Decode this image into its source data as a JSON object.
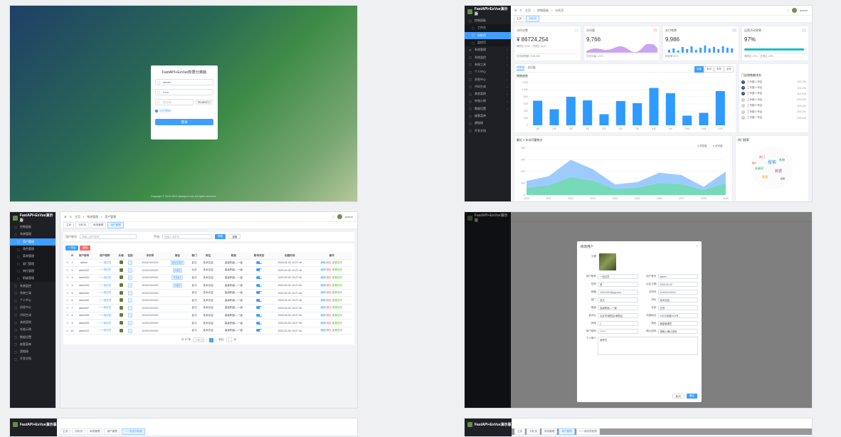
{
  "login": {
    "title": "FastAPI+EsVue权限分离版",
    "username": "admin",
    "password": "••••••",
    "captcha_placeholder": "验证码",
    "captcha_image": "Roded二",
    "remember": "记住密码",
    "submit": "登录",
    "copyright": "Copyright © 2019-2024 ujtangson.com All rights reserved."
  },
  "shell": {
    "brand": "FastAPI+EsVue演示版",
    "user": "admin",
    "breadcrumb": [
      "主页",
      "系统管理",
      "用户管理"
    ],
    "menu": [
      {
        "label": "控制面板",
        "icon": "▢"
      },
      {
        "label": "工作台",
        "icon": "▢",
        "sub": true
      },
      {
        "label": "分析页",
        "icon": "▢",
        "sub": true,
        "active": true
      },
      {
        "label": "监控页",
        "icon": "▢",
        "sub": true
      },
      {
        "label": "系统管理",
        "icon": "⚙",
        "arrow": "⌄"
      },
      {
        "label": "系统监控",
        "icon": "▢",
        "arrow": "⌄"
      },
      {
        "label": "系统工具",
        "icon": "▢",
        "arrow": "⌄"
      },
      {
        "label": "个人中心",
        "icon": "▢",
        "arrow": "⌄"
      },
      {
        "label": "消息中心",
        "icon": "▢",
        "arrow": "⌄"
      },
      {
        "label": "代码生成",
        "icon": "▢",
        "arrow": "⌄"
      },
      {
        "label": "其他案例",
        "icon": "▢",
        "arrow": "⌄"
      },
      {
        "label": "外链示例",
        "icon": "▢",
        "arrow": "⌄"
      },
      {
        "label": "数据设置",
        "icon": "▢",
        "arrow": "⌄"
      },
      {
        "label": "嵌套菜单",
        "icon": "▢"
      },
      {
        "label": "超链接",
        "icon": "▢"
      },
      {
        "label": "开发文档",
        "icon": "▢"
      }
    ]
  },
  "dashboard": {
    "tabs": [
      "主页",
      "分析页"
    ],
    "cards": [
      {
        "title": "访问次数",
        "value": "¥ 86724,254",
        "sub": "周同比 12% ↑  日同比 11% ↓",
        "foot": "日均销售额 ￥86,000",
        "badge_color": "#e6f7ff"
      },
      {
        "title": "访问量",
        "value": "9,766",
        "sub": "",
        "foot": "日访问量 1,970",
        "badge_color": "#fde2e2"
      },
      {
        "title": "支付笔数",
        "value": "9,986",
        "sub": "",
        "foot": "转化率 60%",
        "badge_color": "#d9ecff"
      },
      {
        "title": "运营活动效果",
        "value": "97%",
        "sub": "",
        "foot": "周同比 47% ↑  日同比 12% ↓",
        "badge_color": "#e1f3d8",
        "progress": 0.97
      }
    ],
    "panel_tabs": [
      "销售额",
      "访问量"
    ],
    "panel_title": "销售趋势",
    "range_buttons": [
      "本周",
      "本月",
      "本年",
      "全年"
    ],
    "rank_title": "门店销售额排名",
    "rank": [
      {
        "n": "1",
        "name": "工专路 1 号店",
        "v": "323,234"
      },
      {
        "n": "2",
        "name": "工专路 2 号店",
        "v": "323,234"
      },
      {
        "n": "3",
        "name": "工专路 3 号店",
        "v": "323,234"
      },
      {
        "n": "4",
        "name": "工专路 4 号店",
        "v": "323,234"
      },
      {
        "n": "5",
        "name": "工专路 5 号店",
        "v": "323,234"
      },
      {
        "n": "6",
        "name": "工专路 6 号店",
        "v": "323,234"
      },
      {
        "n": "7",
        "name": "工专路 7 号店",
        "v": "323,234"
      }
    ],
    "lower_title": "最近 1 年访问量统计",
    "legend": [
      "浏览量",
      "访问量"
    ],
    "cloud_title": "热门搜索"
  },
  "chart_data": [
    {
      "type": "bar",
      "categories": [
        "1月",
        "2月",
        "3月",
        "4月",
        "5月",
        "6月",
        "7月",
        "8月",
        "9月",
        "10月",
        "11月",
        "12月"
      ],
      "values": [
        690,
        450,
        800,
        700,
        310,
        680,
        620,
        1050,
        900,
        270,
        350,
        960
      ],
      "ylim": [
        0,
        1200
      ],
      "yticks": [
        "0",
        "200",
        "400",
        "600",
        "800",
        "1,000",
        "1,200"
      ],
      "color": "#2f9bff"
    },
    {
      "type": "area",
      "x": [
        "2020",
        "2021",
        "2022",
        "2023",
        "2024",
        "2025",
        "2026",
        "2027",
        "2028",
        "2029"
      ],
      "series": [
        {
          "name": "浏览量",
          "values": [
            120,
            160,
            300,
            220,
            90,
            110,
            190,
            170,
            70,
            200
          ],
          "color": "#8cc3fb"
        },
        {
          "name": "访问量",
          "values": [
            60,
            80,
            150,
            120,
            50,
            60,
            100,
            90,
            40,
            100
          ],
          "color": "#72dab0"
        }
      ],
      "ylim": [
        0,
        400
      ],
      "yticks": [
        "0",
        "100",
        "200",
        "300",
        "400"
      ]
    }
  ],
  "users": {
    "tabs": [
      "主页",
      "分析页",
      "系统管理",
      "用户管理"
    ],
    "search_label": "用户账号",
    "search_placeholder": "请输入用户账号",
    "phone_label": "手机",
    "phone_placeholder": "请输入手机号",
    "search_btn": "搜索",
    "reset_btn": "重置",
    "add_btn": "+ 添加",
    "del_btn": "删除",
    "columns": [
      "",
      "ID",
      "用户账号",
      "用户昵称",
      "头像",
      "性别",
      "手机号",
      "角色",
      "部门",
      "岗位",
      "职级",
      "账号状态",
      "创建时间",
      "操作"
    ],
    "rows": [
      {
        "id": "1",
        "acc": "admin",
        "nick": "一一测试员",
        "phone": "1XXXXXXXXX",
        "role": "超级管理员",
        "dept": "武汉",
        "post": "技术总监",
        "level": "高级职级—一级",
        "time": "2023-02-02 10:27:16"
      },
      {
        "id": "2",
        "acc": "admin02",
        "nick": "一一测试员",
        "phone": "1XXXXXXXXX",
        "role": "管理员",
        "dept": "北京",
        "post": "技术总监",
        "level": "高级职级—一级",
        "time": "2023-02-02 10:27:16"
      },
      {
        "id": "3",
        "acc": "admin03",
        "nick": "一一测试员",
        "phone": "1XXXXXXXXX",
        "role": "普通用户",
        "dept": "武汉",
        "post": "技术总监",
        "level": "高级职级—一级",
        "time": "2023-02-02 10:27:16"
      },
      {
        "id": "4",
        "acc": "admin04",
        "nick": "一一测试员",
        "phone": "1XXXXXXXXX",
        "role": "管理员",
        "dept": "武汉",
        "post": "技术总监",
        "level": "高级职级—一级",
        "time": "2023-02-02 10:27:16"
      },
      {
        "id": "5",
        "acc": "admin05",
        "nick": "一一测试员",
        "phone": "1XXXXXXXXX",
        "role": "",
        "dept": "武汉",
        "post": "技术总监",
        "level": "高级职级—一级",
        "time": "2023-02-02 10:27:16"
      },
      {
        "id": "6",
        "acc": "admin06",
        "nick": "一一测试员",
        "phone": "1XXXXXXXXX",
        "role": "",
        "dept": "武汉",
        "post": "技术总监",
        "level": "高级职级—一级",
        "time": "2023-02-02 10:27:16"
      },
      {
        "id": "7",
        "acc": "admin07",
        "nick": "一一测试员",
        "phone": "1XXXXXXXXX",
        "role": "",
        "dept": "武汉",
        "post": "技术总监",
        "level": "高级职级—一级",
        "time": "2023-02-02 10:27:16"
      },
      {
        "id": "8",
        "acc": "admin08",
        "nick": "一一测试员",
        "phone": "1XXXXXXXXX",
        "role": "",
        "dept": "武汉",
        "post": "技术总监",
        "level": "高级职级—一级",
        "time": "2023-02-02 10:27:16"
      },
      {
        "id": "9",
        "acc": "admin09",
        "nick": "一一测试员",
        "phone": "1XXXXXXXXX",
        "role": "",
        "dept": "武汉",
        "post": "技术总监",
        "level": "高级职级—一级",
        "time": "2023-02-02 10:27:16"
      },
      {
        "id": "10",
        "acc": "admin10",
        "nick": "一一测试员",
        "phone": "1XXXXXXXXX",
        "role": "",
        "dept": "武汉",
        "post": "技术总监",
        "level": "高级职级—一级",
        "time": "2023-02-02 10:27:16"
      }
    ],
    "ops": {
      "edit": "编辑",
      "del": "删除",
      "reset": "重置密码"
    },
    "pager": {
      "total": "共 10 条",
      "size": "10条/页",
      "page": "1",
      "goto": "前往",
      "goto_page": "1",
      "unit": "页"
    },
    "side_menu": [
      "控制面板",
      "系统管理",
      "用户管理",
      "角色管理",
      "菜单管理",
      "部门管理",
      "岗位管理",
      "职级管理",
      "系统监控",
      "系统工具",
      "个人中心",
      "消息中心",
      "代码生成",
      "其他案例",
      "外链示例",
      "数据设置",
      "嵌套菜单",
      "超链接",
      "开发文档"
    ]
  },
  "modal": {
    "title": "修改用户",
    "close": "×",
    "avatar_label": "头像",
    "fields": [
      {
        "label": "用户昵称",
        "value": "一测试员"
      },
      {
        "label": "用户账号",
        "value": "admin"
      },
      {
        "label": "性别",
        "value": "男"
      },
      {
        "label": "出生日期",
        "value": "2023-02-02"
      },
      {
        "label": "邮箱",
        "value": "1XXXXXX@qq.com"
      },
      {
        "label": "手机号",
        "value": "1XXXXXXXXX"
      },
      {
        "label": "部门",
        "value": "武汉"
      },
      {
        "label": "岗位",
        "value": "技术总监"
      },
      {
        "label": "职级",
        "value": "高级职级—一级"
      },
      {
        "label": "状态",
        "value": "正常"
      },
      {
        "label": "省市区",
        "value": "北京市/朝阳区/朝阳区"
      },
      {
        "label": "详细地址",
        "value": "XXXX街道XXX号"
      },
      {
        "label": "排序",
        "value": "1"
      },
      {
        "label": "角色",
        "value": "超级管理员"
      },
      {
        "label": "用户密码",
        "value": "******"
      },
      {
        "label": "确认密码",
        "value": "请输入确认密码"
      }
    ],
    "remark_label": "个人简介",
    "remark_value": "管理员",
    "cancel": "取消",
    "ok": "确定"
  },
  "bottom": {
    "brand": "FastAPI+EsVue演示版",
    "tabs": [
      "主页",
      "分析页",
      "系统管理",
      "用户管理",
      "一一测试员权限"
    ]
  }
}
